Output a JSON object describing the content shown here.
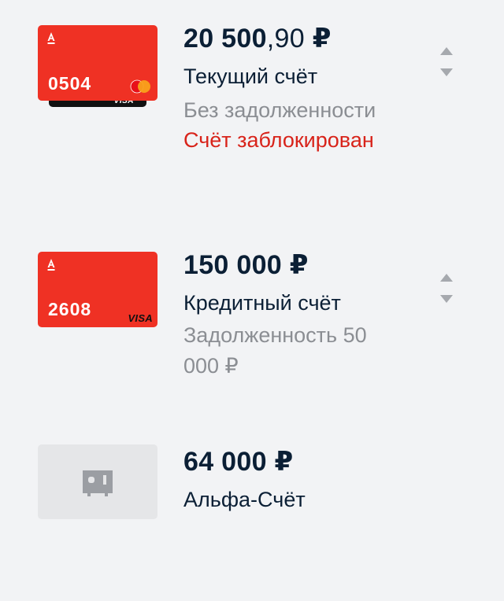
{
  "accounts": [
    {
      "card_number": "0504",
      "card_brand": "mastercard",
      "card_brand_behind": "VISA",
      "amount_int": "20 500",
      "amount_frac": ",90",
      "currency": "₽",
      "name": "Текущий счёт",
      "status": "Без задолженности",
      "alert": "Счёт заблокирован",
      "card_color": "#ef3124"
    },
    {
      "card_number": "2608",
      "card_brand": "VISA",
      "amount_int": "150 000",
      "amount_frac": "",
      "currency": "₽",
      "name": "Кредитный счёт",
      "status": "Задолженность 50 000 ₽",
      "card_color": "#ef3124"
    },
    {
      "icon": "safe-icon",
      "amount_int": "64 000",
      "amount_frac": "",
      "currency": "₽",
      "name": "Альфа-Счёт"
    }
  ],
  "colors": {
    "background": "#f2f3f5",
    "accent_red": "#ef3124",
    "alert_text": "#d8231a",
    "secondary_text": "#8b8e93"
  },
  "icons": {
    "reorder": "sort-handle-icon",
    "bank_logo": "alfa-logo-icon"
  }
}
